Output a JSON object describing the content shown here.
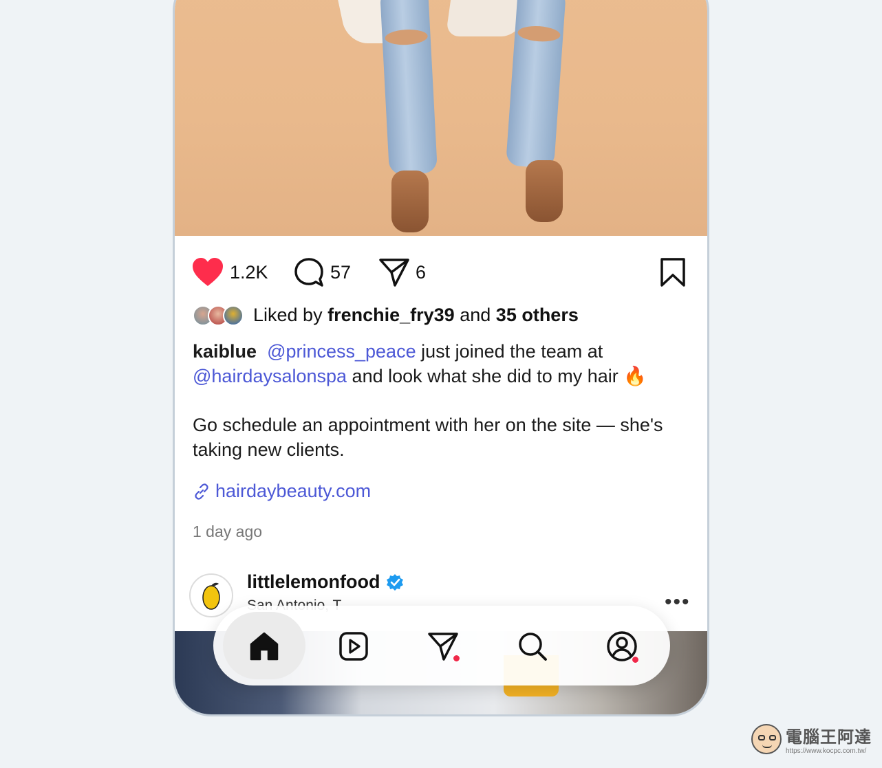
{
  "post": {
    "likes_count": "1.2K",
    "comments_count": "57",
    "shares_count": "6",
    "liked_by_prefix": "Liked by",
    "liked_by_user": "frenchie_fry39",
    "liked_by_and": "and",
    "liked_by_others": "35 others",
    "author": "kaiblue",
    "mention_1": "@princess_peace",
    "caption_part_1": " just joined the team at",
    "mention_2": "@hairdaysalonspa",
    "caption_part_2": " and look what she did to my hair 🔥",
    "caption_para_2": "Go schedule an appointment with her on the site — she's taking new clients.",
    "link_text": "hairdaybeauty.com",
    "timestamp": "1 day ago"
  },
  "next_post": {
    "username": "littlelemonfood",
    "location": "San Antonio, T",
    "verified": true,
    "more_label": "•••"
  },
  "nav": {
    "items": [
      {
        "name": "home",
        "icon": "home-icon",
        "active": true
      },
      {
        "name": "reels",
        "icon": "reels-icon",
        "active": false
      },
      {
        "name": "messages",
        "icon": "send-icon",
        "active": false,
        "badge": true
      },
      {
        "name": "search",
        "icon": "search-icon",
        "active": false
      },
      {
        "name": "profile",
        "icon": "profile-icon",
        "active": false,
        "badge": true
      }
    ]
  },
  "watermark": {
    "title": "電腦王阿達",
    "url": "https://www.kocpc.com.tw/"
  },
  "colors": {
    "like_red": "#fe2d4c",
    "mention_blue": "#4c58d6",
    "badge_red": "#f02849",
    "verified_blue": "#1d9bf0"
  }
}
